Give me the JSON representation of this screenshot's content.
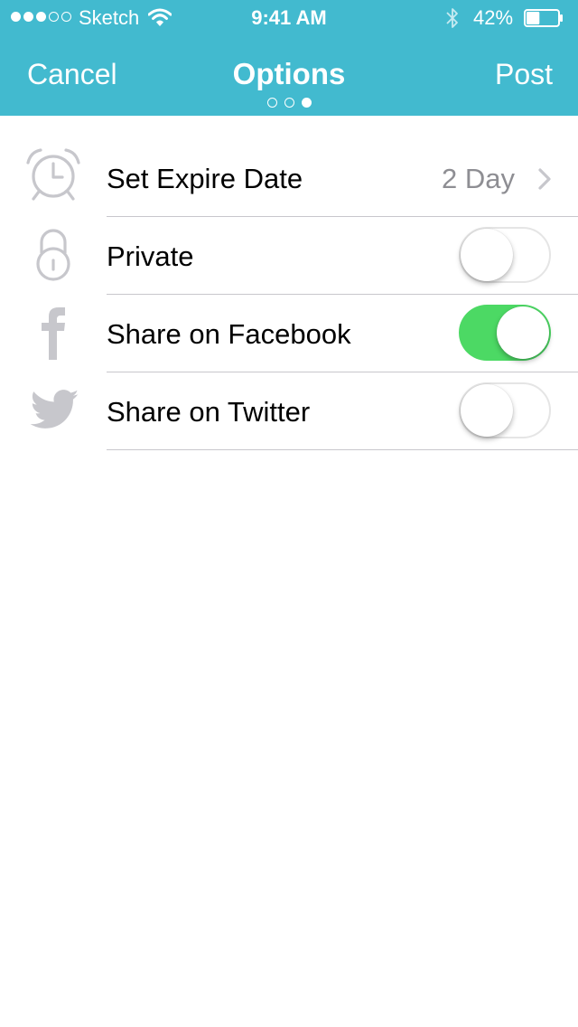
{
  "status_bar": {
    "carrier": "Sketch",
    "time": "9:41 AM",
    "battery_percent": "42%",
    "battery_level": 0.42,
    "signal_bars_filled": 3,
    "signal_bars_total": 5
  },
  "nav": {
    "cancel_label": "Cancel",
    "title": "Options",
    "post_label": "Post",
    "page_count": 3,
    "current_page": 3
  },
  "colors": {
    "accent": "#42bacf",
    "toggle_on": "#4cd964",
    "icon_gray": "#c7c7cc",
    "value_gray": "#8e8e93"
  },
  "options": [
    {
      "icon": "alarm-clock-icon",
      "label": "Set Expire Date",
      "value": "2 Day",
      "control": "disclosure"
    },
    {
      "icon": "lock-icon",
      "label": "Private",
      "control": "toggle",
      "on": false
    },
    {
      "icon": "facebook-icon",
      "label": "Share on Facebook",
      "control": "toggle",
      "on": true
    },
    {
      "icon": "twitter-icon",
      "label": "Share on Twitter",
      "control": "toggle",
      "on": false
    }
  ]
}
